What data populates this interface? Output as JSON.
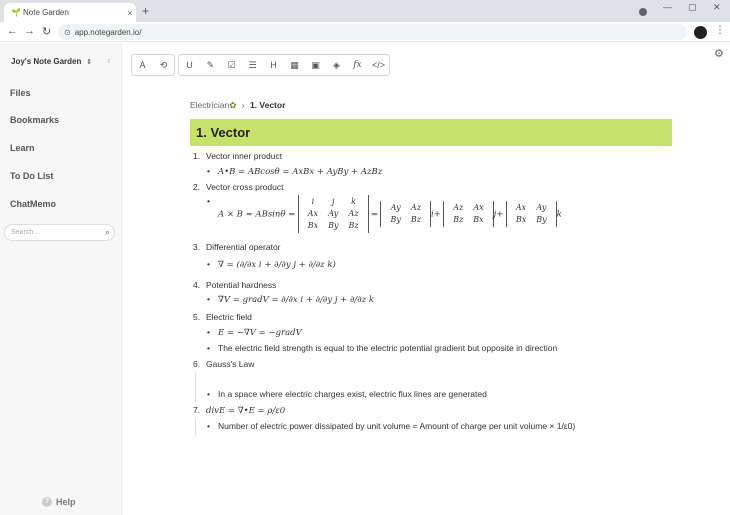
{
  "browser": {
    "tab_title": "Note Garden",
    "tab_close": "×",
    "new_tab": "+",
    "min": "—",
    "max": "▢",
    "close": "✕",
    "url": "app.notegarden.io/"
  },
  "sidebar": {
    "brand": "Joy's Note Garden",
    "items": [
      {
        "label": "Files"
      },
      {
        "label": "Bookmarks"
      },
      {
        "label": "Learn"
      },
      {
        "label": "To Do List"
      },
      {
        "label": "ChatMemo"
      }
    ],
    "search_placeholder": "Search...",
    "help": "Help"
  },
  "toolbar": {
    "buttons": [
      "A",
      "⟲",
      "U",
      "✎",
      "☑",
      "☰",
      "H",
      "▦",
      "▣",
      "◈",
      "fx",
      "</>"
    ]
  },
  "page": {
    "breadcrumb_parent": "Electrician",
    "breadcrumb_sep": "›",
    "breadcrumb_current": "1. Vector",
    "heading": "1. Vector",
    "items": [
      {
        "num": "1.",
        "text": "Vector inner product",
        "formula": "A•B = ABcosθ = AxBx + AyBy + AzBz"
      },
      {
        "num": "2.",
        "text": "Vector cross product",
        "formula_left": "A × B = ABsinθ ="
      },
      {
        "num": "3.",
        "text": "Differential operator",
        "formula": "∇ = (∂/∂x i + ∂/∂y j + ∂/∂z k)"
      },
      {
        "num": "4.",
        "text": "Potential hardness",
        "formula": "∇V = gradV = ∂/∂x i + ∂/∂y j + ∂/∂z k"
      },
      {
        "num": "5.",
        "text": "Electric field",
        "formula": "E = −∇V = −gradV",
        "note": "The electric field strength is equal to the electric potential gradient but opposite in direction"
      },
      {
        "num": "6.",
        "text": "Gauss's Law",
        "note": "In a space where electric charges exist, electric flux lines are generated"
      },
      {
        "num": "7.",
        "text": "divE = ∇•E = ρ/ε0",
        "note": "Number of electric power dissipated by unit volume = Amount of charge per unit volume × 1/ε0)"
      }
    ]
  }
}
